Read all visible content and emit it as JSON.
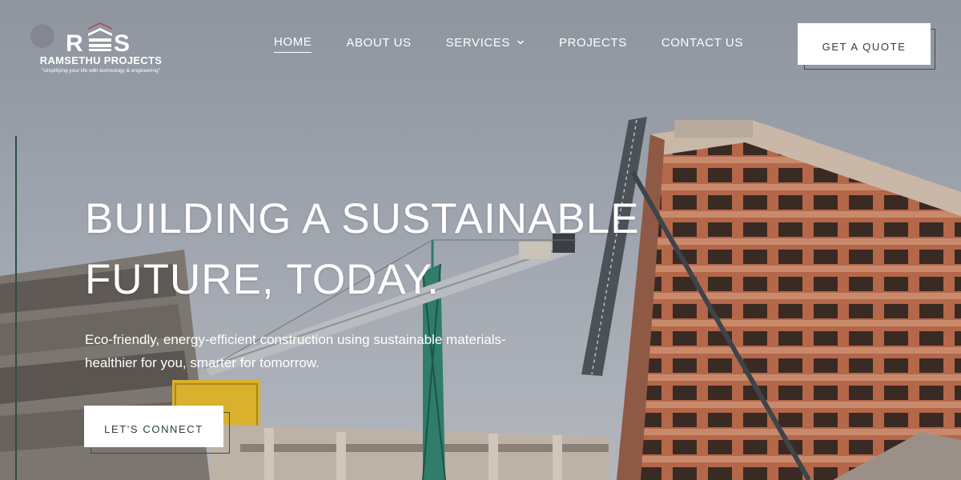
{
  "brand": {
    "name": "RAMSETHU PROJECTS",
    "tagline": "\"simplifying your life with technology & engineering\"",
    "logo_letters": "RS"
  },
  "nav": {
    "items": [
      {
        "label": "HOME",
        "active": true
      },
      {
        "label": "ABOUT US",
        "active": false
      },
      {
        "label": "SERVICES",
        "active": false,
        "has_dropdown": true
      },
      {
        "label": "PROJECTS",
        "active": false
      },
      {
        "label": "CONTACT US",
        "active": false
      }
    ],
    "quote_button": "GET A QUOTE"
  },
  "hero": {
    "title_line1": "BUILDING A SUSTAINABLE",
    "title_line2": "FUTURE, TODAY.",
    "subtitle_line1": "Eco-friendly, energy-efficient construction using sustainable materials-",
    "subtitle_line2": "healthier for you, smarter for tomorrow.",
    "cta_button": "LET'S CONNECT"
  },
  "colors": {
    "sky": "#9aa0aa",
    "brick": "#b96a4c",
    "crane": "#2f7d6a",
    "button_text": "#2b3e3a",
    "accent_line": "#2d4f40"
  }
}
